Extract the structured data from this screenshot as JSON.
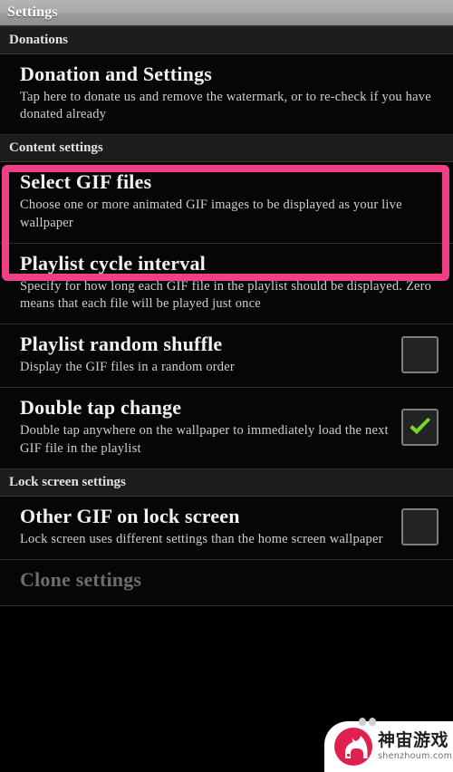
{
  "window": {
    "title": "Settings"
  },
  "sections": [
    {
      "id": "donations",
      "header": "Donations",
      "items": [
        {
          "id": "donation-and-settings",
          "title": "Donation and Settings",
          "summary": "Tap here to donate us and remove the watermark, or to re-check if you have donated already",
          "widget": "none"
        }
      ]
    },
    {
      "id": "content-settings",
      "header": "Content settings",
      "items": [
        {
          "id": "select-gif-files",
          "title": "Select GIF files",
          "summary": "Choose one or more animated GIF images to be displayed as your live wallpaper",
          "widget": "none",
          "highlighted": true
        },
        {
          "id": "playlist-cycle-interval",
          "title": "Playlist cycle interval",
          "summary": "Specify for how long each GIF file in the playlist should be displayed. Zero means that each file will be played just once",
          "widget": "none"
        },
        {
          "id": "playlist-random-shuffle",
          "title": "Playlist random shuffle",
          "summary": "Display the GIF files in a random order",
          "widget": "checkbox",
          "checked": false
        },
        {
          "id": "double-tap-change",
          "title": "Double tap change",
          "summary": "Double tap anywhere on the wallpaper to immediately load the next GIF file in the playlist",
          "widget": "checkbox",
          "checked": true
        }
      ]
    },
    {
      "id": "lock-screen-settings",
      "header": "Lock screen settings",
      "items": [
        {
          "id": "other-gif-on-lock-screen",
          "title": "Other GIF on lock screen",
          "summary": "Lock screen uses different settings than the home screen wallpaper",
          "widget": "checkbox",
          "checked": false
        },
        {
          "id": "clone-settings",
          "title": "Clone settings",
          "summary": "",
          "widget": "none",
          "dim": true
        }
      ]
    }
  ],
  "watermark": {
    "brand_cn": "神宙游戏",
    "url": "shenzhoum.com"
  },
  "colors": {
    "highlight": "#ef3f86",
    "check": "#76d628",
    "titlebar_text": "#ffffff",
    "background": "#000000",
    "section_header_bg": "#1c1c1c",
    "watermark_logo": "#e0204f"
  }
}
